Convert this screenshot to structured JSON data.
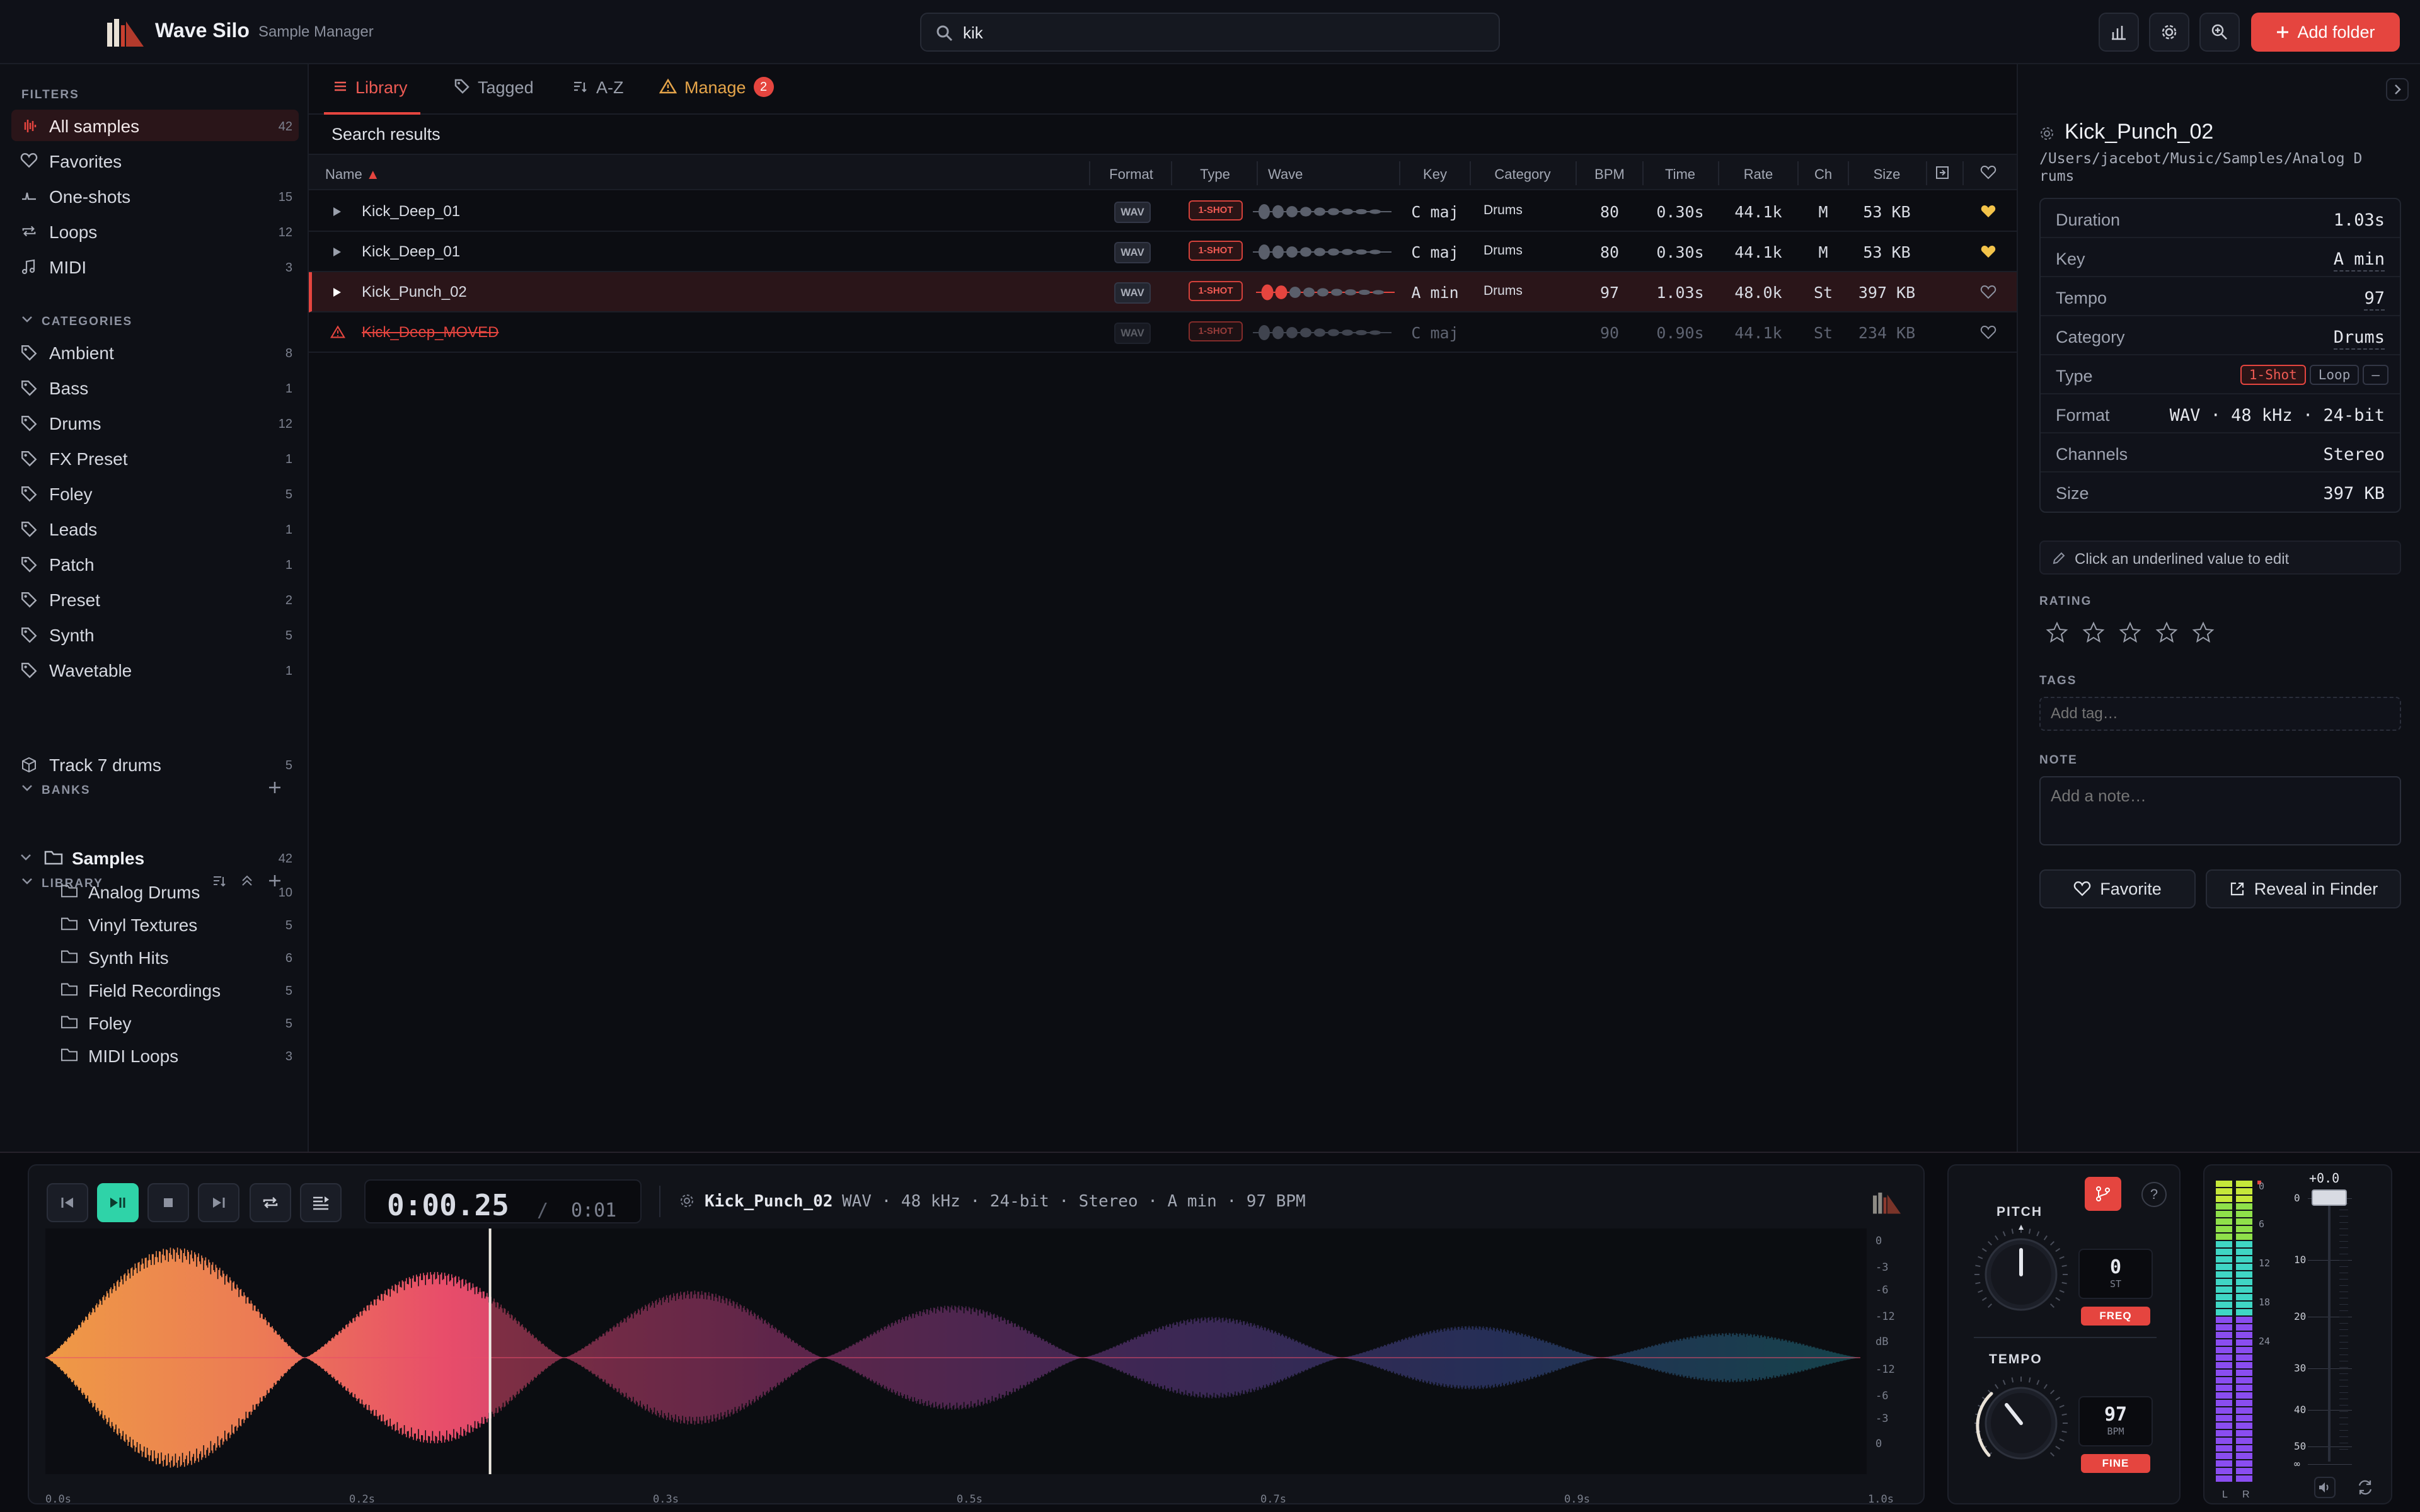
{
  "app": {
    "title": "Wave Silo",
    "subtitle": "Sample Manager"
  },
  "search": {
    "value": "kik",
    "placeholder": ""
  },
  "toolbar": {
    "add_folder_label": "Add folder",
    "icons": [
      "chart-icon",
      "gear-icon",
      "zoom-in-icon",
      "plus-icon"
    ]
  },
  "sidebar": {
    "filters_title": "FILTERS",
    "filters": [
      {
        "label": "All samples",
        "count": "42",
        "icon": "waveform-icon"
      },
      {
        "label": "Favorites",
        "count": "",
        "icon": "heart-icon"
      },
      {
        "label": "One-shots",
        "count": "15",
        "icon": "oneshot-icon"
      },
      {
        "label": "Loops",
        "count": "12",
        "icon": "loop-icon"
      },
      {
        "label": "MIDI",
        "count": "3",
        "icon": "note-icon"
      }
    ],
    "categories_title": "CATEGORIES",
    "categories": [
      {
        "label": "Ambient",
        "count": "8"
      },
      {
        "label": "Bass",
        "count": "1"
      },
      {
        "label": "Drums",
        "count": "12"
      },
      {
        "label": "FX Preset",
        "count": "1"
      },
      {
        "label": "Foley",
        "count": "5"
      },
      {
        "label": "Leads",
        "count": "1"
      },
      {
        "label": "Patch",
        "count": "1"
      },
      {
        "label": "Preset",
        "count": "2"
      },
      {
        "label": "Synth",
        "count": "5"
      },
      {
        "label": "Wavetable",
        "count": "1"
      }
    ],
    "banks_title": "BANKS",
    "banks": [
      {
        "label": "Track 7 drums",
        "count": "5"
      }
    ],
    "library_title": "LIBRARY",
    "library_root": {
      "label": "Samples",
      "count": "42"
    },
    "library_folders": [
      {
        "label": "Analog Drums",
        "count": "10"
      },
      {
        "label": "Vinyl Textures",
        "count": "5"
      },
      {
        "label": "Synth Hits",
        "count": "6"
      },
      {
        "label": "Field Recordings",
        "count": "5"
      },
      {
        "label": "Foley",
        "count": "5"
      },
      {
        "label": "MIDI Loops",
        "count": "3"
      }
    ]
  },
  "tabs": [
    {
      "label": "Library",
      "icon": "list-icon"
    },
    {
      "label": "Tagged",
      "icon": "tag-icon"
    },
    {
      "label": "A-Z",
      "icon": "sort-icon"
    },
    {
      "label": "Manage",
      "icon": "warning-icon",
      "badge": "2"
    }
  ],
  "results_label": "Search results",
  "table": {
    "headers": {
      "name": "Name",
      "format": "Format",
      "type": "Type",
      "wave": "Wave",
      "key": "Key",
      "category": "Category",
      "bpm": "BPM",
      "time": "Time",
      "rate": "Rate",
      "ch": "Ch",
      "size": "Size"
    },
    "rows": [
      {
        "name": "Kick_Deep_01",
        "format": "WAV",
        "type": "1-SHOT",
        "key": "C maj",
        "category": "Drums",
        "bpm": "80",
        "time": "0.30s",
        "rate": "44.1k",
        "ch": "M",
        "size": "53 KB",
        "favorite": true,
        "state": "normal"
      },
      {
        "name": "Kick_Deep_01",
        "format": "WAV",
        "type": "1-SHOT",
        "key": "C maj",
        "category": "Drums",
        "bpm": "80",
        "time": "0.30s",
        "rate": "44.1k",
        "ch": "M",
        "size": "53 KB",
        "favorite": true,
        "state": "normal"
      },
      {
        "name": "Kick_Punch_02",
        "format": "WAV",
        "type": "1-SHOT",
        "key": "A min",
        "category": "Drums",
        "bpm": "97",
        "time": "1.03s",
        "rate": "48.0k",
        "ch": "St",
        "size": "397 KB",
        "favorite": false,
        "state": "selected"
      },
      {
        "name": "Kick_Deep_MOVED",
        "format": "WAV",
        "type": "1-SHOT",
        "key": "C maj",
        "category": "",
        "bpm": "90",
        "time": "0.90s",
        "rate": "44.1k",
        "ch": "St",
        "size": "234 KB",
        "favorite": false,
        "state": "moved"
      }
    ]
  },
  "detail": {
    "title": "Kick_Punch_02",
    "path": "/Users/jacebot/Music/Samples/Analog Drums",
    "path_line1": "/Users/jacebot/Music/Samples/Analog D",
    "path_line2": "rums",
    "props": [
      {
        "k": "Duration",
        "v": "1.03s"
      },
      {
        "k": "Key",
        "v": "A min"
      },
      {
        "k": "Tempo",
        "v": "97"
      },
      {
        "k": "Category",
        "v": "Drums"
      },
      {
        "k": "Type",
        "v": ""
      },
      {
        "k": "Format",
        "v": "WAV · 48 kHz · 24-bit"
      },
      {
        "k": "Channels",
        "v": "Stereo"
      },
      {
        "k": "Size",
        "v": "397 KB"
      }
    ],
    "type_chips": [
      "1-Shot",
      "Loop",
      "–"
    ],
    "edit_hint": "Click an underlined value to edit",
    "rating_title": "RATING",
    "rating": 0,
    "tags_title": "TAGS",
    "tags_placeholder": "Add tag…",
    "note_title": "NOTE",
    "note_placeholder": "Add a note…",
    "favorite_label": "Favorite",
    "reveal_label": "Reveal in Finder"
  },
  "player": {
    "time": "0:00.25",
    "sep": "/",
    "total": "0:01",
    "info_name": "Kick_Punch_02",
    "info_meta": "WAV · 48 kHz · 24-bit · Stereo · A min · 97 BPM",
    "axis": [
      "0.0s",
      "0.2s",
      "0.3s",
      "0.5s",
      "0.7s",
      "0.9s",
      "1.0s"
    ],
    "db_scale": [
      "0",
      "-3",
      "-6",
      "-12",
      "dB",
      "-12",
      "-6",
      "-3",
      "0"
    ],
    "playhead_fraction": 0.245
  },
  "knobs": {
    "pitch_label": "PITCH",
    "pitch_value": "0",
    "pitch_unit": "ST",
    "pitch_mode": "FREQ",
    "tempo_label": "TEMPO",
    "tempo_value": "97",
    "tempo_unit": "BPM",
    "tempo_mode": "FINE",
    "help": "?"
  },
  "meters": {
    "gain": "+0.0",
    "fader_scale": [
      "0",
      "10",
      "20",
      "30",
      "40",
      "50",
      "∞"
    ],
    "meter_scale": [
      "0",
      "6",
      "12",
      "18",
      "24"
    ],
    "channels": [
      "L",
      "R"
    ]
  },
  "colors": {
    "accent": "#e5453f",
    "play": "#2fd3a8",
    "favorite": "#f3c34a"
  }
}
